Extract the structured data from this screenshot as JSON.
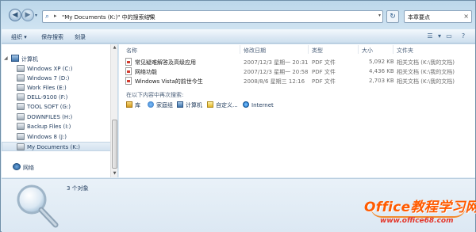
{
  "address": {
    "path_text": "\"My Documents (K:)\" 中的搜索结果",
    "separator": "▸"
  },
  "search": {
    "query": "本章要点"
  },
  "toolbar": {
    "organize": "组织 ▾",
    "save_search": "保存搜索",
    "burn": "刻录"
  },
  "nav": {
    "computer_label": "计算机",
    "drives": [
      "Windows XP (C:)",
      "Windows 7 (D:)",
      "Work Files (E:)",
      "DELL-9100 (F:)",
      "TOOL SOFT (G:)",
      "DOWNFILES (H:)",
      "Backup Files (I:)",
      "Windows 8 (J:)",
      "My Documents (K:)"
    ],
    "network_label": "网络"
  },
  "columns": {
    "name": "名称",
    "date": "修改日期",
    "type": "类型",
    "size": "大小",
    "folder": "文件夹"
  },
  "files": [
    {
      "name": "常见疑难解答及高级应用",
      "date": "2007/12/3 星期一 20:31",
      "type": "PDF 文件",
      "size": "5,092 KB",
      "folder": "相关文档 (K:\\我的文档)"
    },
    {
      "name": "网络功能",
      "date": "2007/12/3 星期一 20:58",
      "type": "PDF 文件",
      "size": "4,436 KB",
      "folder": "相关文档 (K:\\我的文档)"
    },
    {
      "name": "Windows Vista的前世今生",
      "date": "2008/8/6 星期三 12:16",
      "type": "PDF 文件",
      "size": "2,703 KB",
      "folder": "相关文档 (K:\\我的文档)"
    }
  ],
  "search_again": {
    "label": "在以下内容中再次搜索:",
    "targets": [
      "库",
      "家庭组",
      "计算机",
      "自定义...",
      "Internet"
    ]
  },
  "details": {
    "count": "3 个对象"
  },
  "watermark": {
    "title": "Office教程学习网",
    "url": "www.office68.com"
  }
}
